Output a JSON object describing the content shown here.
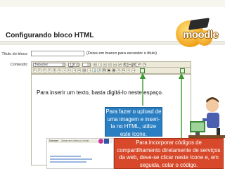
{
  "page": {
    "title": "Configurando bloco HTML"
  },
  "logo": {
    "text": "moodle"
  },
  "form": {
    "title_label": "Título do bloco:",
    "title_hint": "(Deixe em branco para esconder o título)",
    "content_label": "Conteúdo:"
  },
  "toolbar": {
    "font_value": "Trebuchet",
    "size_value": "1 (8 pt)",
    "style_value": "",
    "lang_value": "Língua",
    "row1_buttons": [
      "B",
      "I",
      "U",
      "S",
      "x₂",
      "x²",
      "⎘",
      "✂",
      "⎘",
      "↶",
      "↷"
    ],
    "row2_buttons": [
      "≡",
      "≡",
      "≡",
      "≡",
      "¶",
      "1.",
      "•",
      "⇤",
      "⇥",
      "A",
      "▤",
      "—",
      "⚓",
      "🔗",
      "⛓",
      "▣",
      "▦",
      "☺",
      "Ω",
      "⌕",
      "<>"
    ]
  },
  "annotations": {
    "instruction": "Para inserir um texto, basta digitá-lo neste espaço.",
    "image_callout": "Para fazer o upload de uma imagem e inseri-la no HTML, utilize este ícone.",
    "html_callout": "Para incorporar códigos de compartilhamento diretamente de serviços da web, deve-se clicar neste ícone e, em seguida, colar o código."
  },
  "embedded_screenshot": {
    "label": "Nomear",
    "input_text": "Zonar em vídeo p/ a mar"
  },
  "colors": {
    "image_callout_bg": "#2a7fc3",
    "html_callout_bg": "#d8492b",
    "highlight_border": "#3a7d2e",
    "logo_orange": "#f0a21a"
  }
}
